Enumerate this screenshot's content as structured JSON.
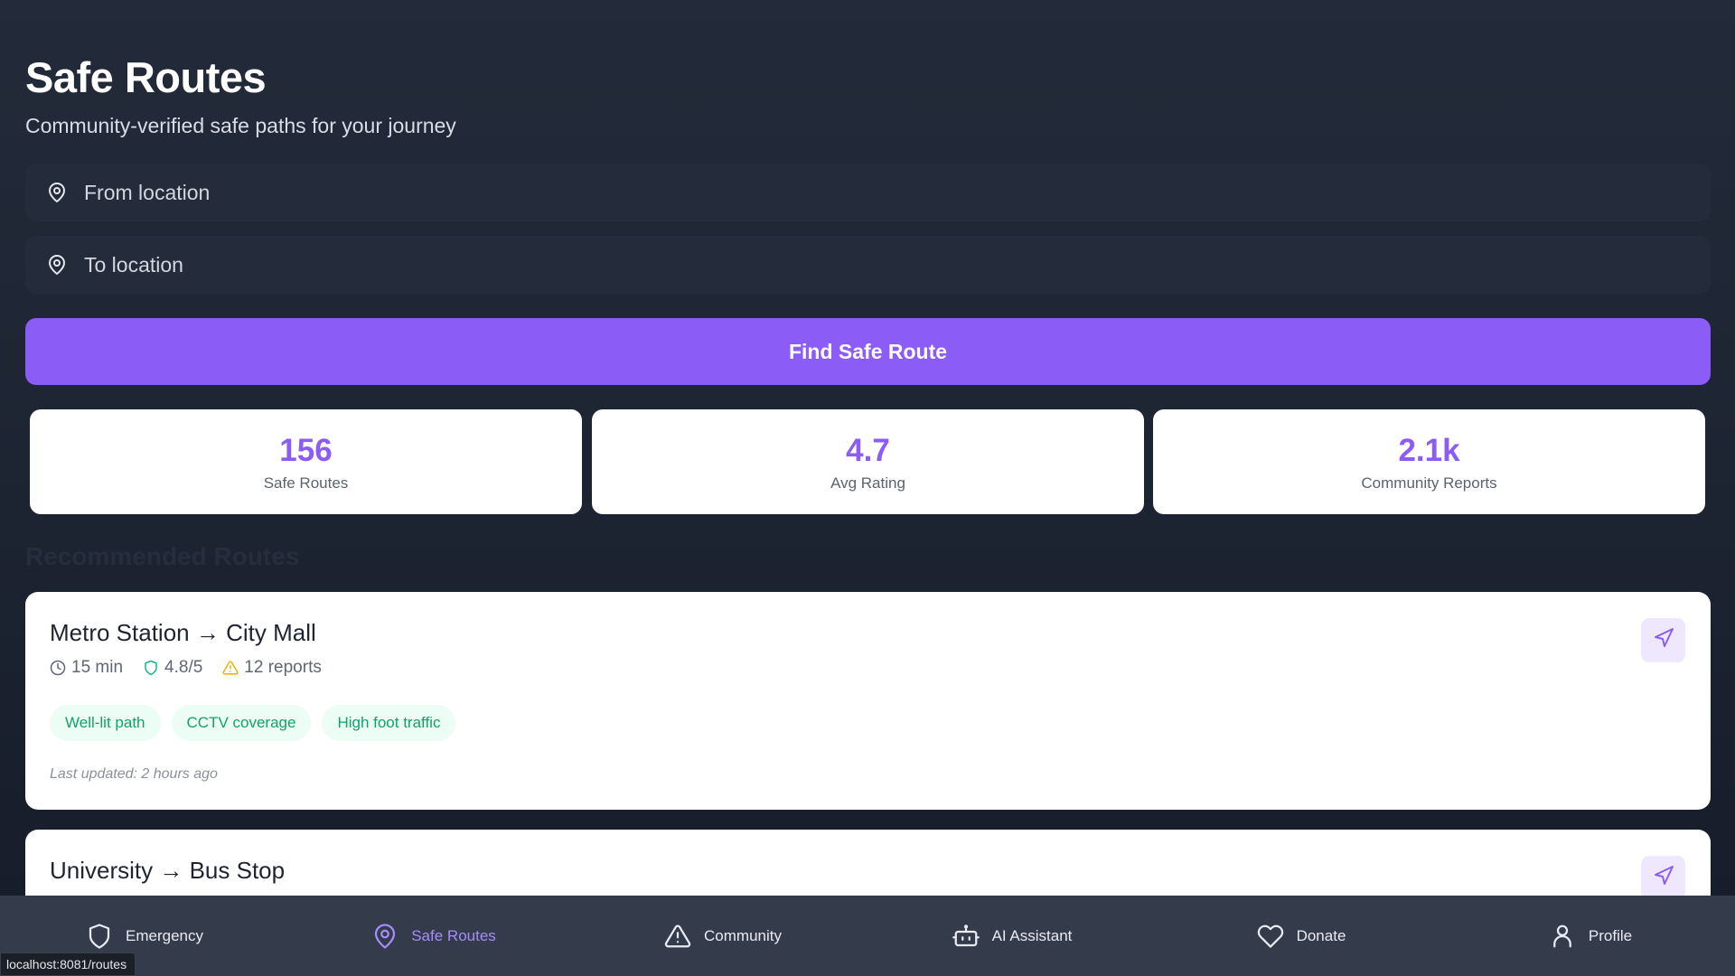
{
  "header": {
    "title": "Safe Routes",
    "subtitle": "Community-verified safe paths for your journey"
  },
  "search": {
    "from_placeholder": "From location",
    "to_placeholder": "To location",
    "from_icon": "map-pin-icon",
    "to_icon": "map-pin-icon",
    "button_label": "Find Safe Route"
  },
  "stats": [
    {
      "value": "156",
      "label": "Safe Routes"
    },
    {
      "value": "4.7",
      "label": "Avg Rating"
    },
    {
      "value": "2.1k",
      "label": "Community Reports"
    }
  ],
  "section_title": "Recommended Routes",
  "routes": [
    {
      "title": "Metro Station → City Mall",
      "duration": "15 min",
      "rating": "4.8/5",
      "reports": "12 reports",
      "tags": [
        "Well-lit path",
        "CCTV coverage",
        "High foot traffic"
      ],
      "updated": "Last updated: 2 hours ago"
    },
    {
      "title": "University → Bus Stop"
    }
  ],
  "bottom_nav": [
    {
      "label": "Emergency",
      "icon": "shield-icon",
      "active": false
    },
    {
      "label": "Safe Routes",
      "icon": "map-pin-icon",
      "active": true
    },
    {
      "label": "Community",
      "icon": "alert-triangle-icon",
      "active": false
    },
    {
      "label": "AI Assistant",
      "icon": "bot-icon",
      "active": false
    },
    {
      "label": "Donate",
      "icon": "heart-icon",
      "active": false
    },
    {
      "label": "Profile",
      "icon": "user-icon",
      "active": false
    }
  ],
  "status_url": "localhost:8081/routes",
  "colors": {
    "accent": "#8b5cf6",
    "tag_text": "#12a36a",
    "tag_bg": "#ecfdf5",
    "warning": "#eab308",
    "rating_icon": "#10b981",
    "nav_bg": "#343b4b"
  }
}
